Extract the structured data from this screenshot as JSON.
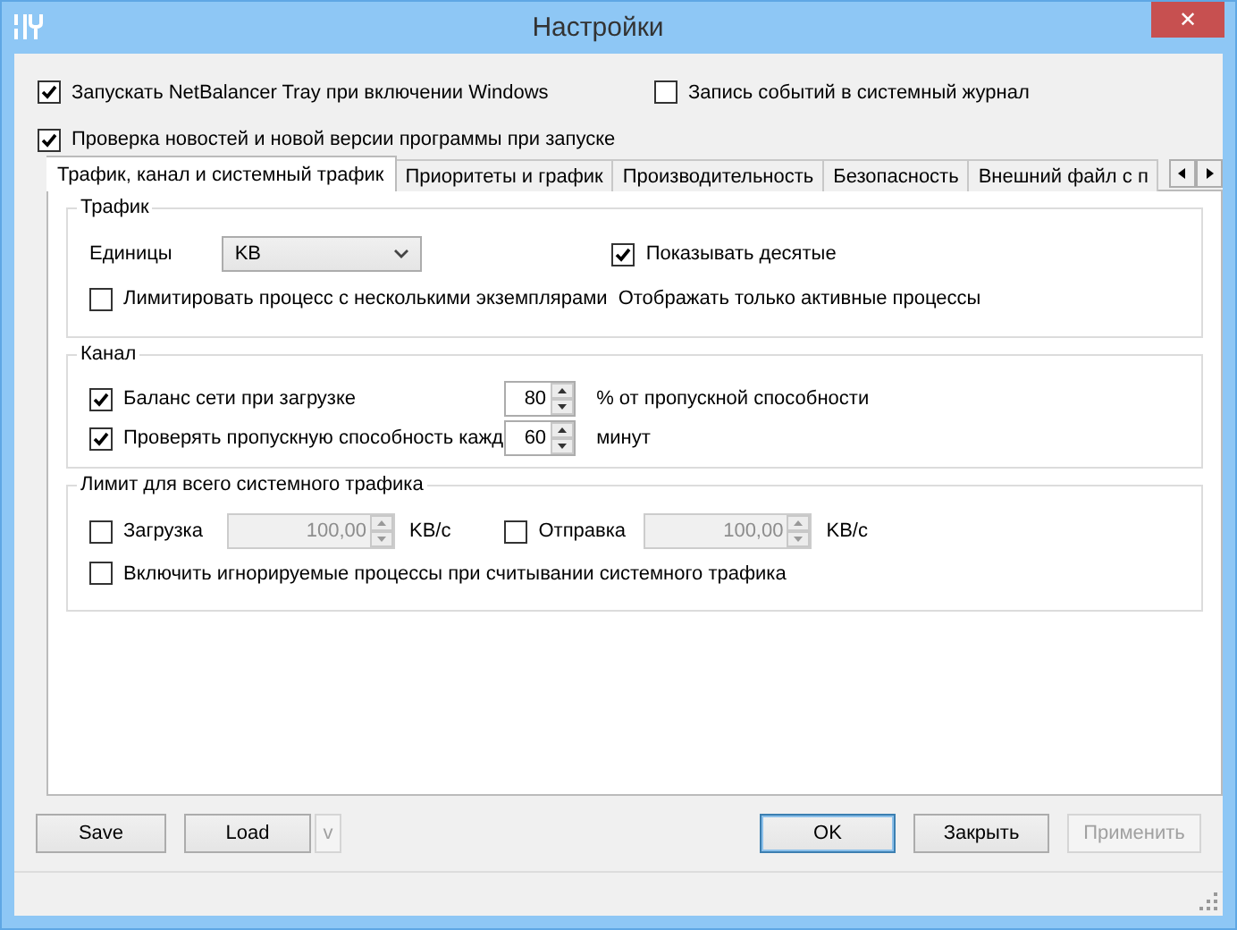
{
  "window": {
    "title": "Настройки",
    "close": "✕"
  },
  "options": [
    {
      "label": "Запускать NetBalancer Tray при включении Windows",
      "checked": true
    },
    {
      "label": "Запись событий в системный журнал",
      "checked": false
    },
    {
      "label": "Проверка новостей и новой версии программы при запуске",
      "checked": true
    }
  ],
  "tabs": [
    {
      "label": "Трафик, канал и системный трафик",
      "selected": true
    },
    {
      "label": "Приоритеты и график",
      "selected": false
    },
    {
      "label": "Производительность",
      "selected": false
    },
    {
      "label": "Безопасность",
      "selected": false
    },
    {
      "label": "Внешний файл с п",
      "selected": false
    }
  ],
  "traffic": {
    "title": "Трафик",
    "units_label": "Единицы",
    "units_value": "KB",
    "show_decimals": {
      "label": "Показывать десятые",
      "checked": true
    },
    "limit_multi": {
      "label": "Лимитировать процесс с несколькими экземплярами",
      "checked": false
    },
    "active_only": "Отображать только активные процессы"
  },
  "channel": {
    "title": "Канал",
    "rows": [
      {
        "label": "Баланс сети при загрузке",
        "checked": true,
        "value": "80",
        "unit": "% от пропускной способности"
      },
      {
        "label": "Проверять пропускную способность кажд",
        "checked": true,
        "value": "60",
        "unit": "минут"
      }
    ]
  },
  "system_limit": {
    "title": "Лимит для всего системного трафика",
    "rows": [
      {
        "label": "Загрузка",
        "checked": false,
        "value": "100,00",
        "disabled": true,
        "unit": "KB/c"
      },
      {
        "label": "Отправка",
        "checked": false,
        "value": "100,00",
        "disabled": true,
        "unit": "KB/c"
      }
    ],
    "include_ignored": {
      "label": "Включить игнорируемые процессы при считывании системного трафика",
      "checked": false
    }
  },
  "buttons": {
    "save": "Save",
    "load": "Load",
    "load_menu": {
      "label": "v",
      "disabled": true
    },
    "ok": {
      "label": "OK",
      "default": true
    },
    "close": "Закрыть",
    "apply": {
      "label": "Применить",
      "disabled": true
    }
  }
}
